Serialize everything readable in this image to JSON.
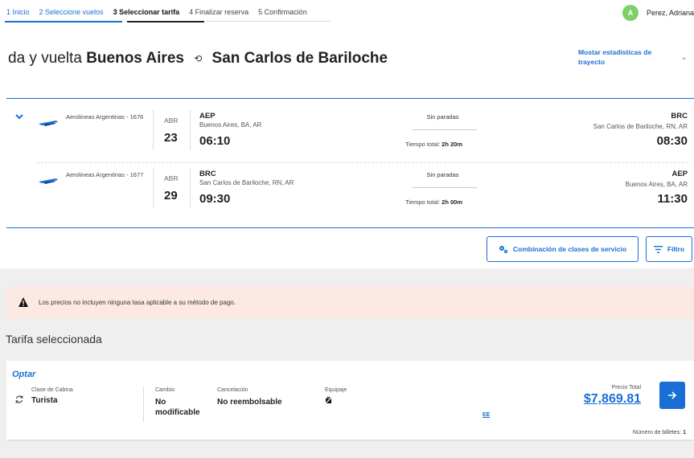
{
  "stepper": {
    "steps": [
      {
        "label": "1  Inicio",
        "state": "done"
      },
      {
        "label": "2  Seleccione vuelos",
        "state": "done"
      },
      {
        "label": "3  Seleccionar tarifa",
        "state": "active"
      },
      {
        "label": "4  Finalizar reserva",
        "state": "pending"
      },
      {
        "label": "5  Confirmación",
        "state": "pending"
      }
    ]
  },
  "user": {
    "initial": "A",
    "name": "Perez, Adriana"
  },
  "header": {
    "title_prefix": "da y vuelta",
    "origin": "Buenos Aires",
    "destination": "San Carlos de Bariloche",
    "stats_link": "Mostar estadísticas de trayecto"
  },
  "flights": [
    {
      "airline": "Aerolineas Argentinas - 1676",
      "month": "ABR",
      "day": "23",
      "dep_code": "AEP",
      "dep_city": "Buenos Aires, BA, AR",
      "dep_time": "06:10",
      "stops": "Sin paradas",
      "total_label": "Tiempo total:",
      "total_value": "2h 20m",
      "arr_code": "BRC",
      "arr_city": "San Carlos de Bariloche, RN, AR",
      "arr_time": "08:30"
    },
    {
      "airline": "Aerolineas Argentinas - 1677",
      "month": "ABR",
      "day": "29",
      "dep_code": "BRC",
      "dep_city": "San Carlos de Bariloche, RN, AR",
      "dep_time": "09:30",
      "stops": "Sin paradas",
      "total_label": "Tiempo total:",
      "total_value": "2h 00m",
      "arr_code": "AEP",
      "arr_city": "Buenos Aires, BA, AR",
      "arr_time": "11:30"
    }
  ],
  "toolbar": {
    "combo_label": "Combinación de clases de servicio",
    "filter_label": "Filtro"
  },
  "alert": {
    "text": "Los precios no incluyen ninguna tasa aplicable a su método de pago."
  },
  "tarifa": {
    "section_title": "Tarifa seleccionada",
    "optar": "Optar",
    "cabin_label": "Clase de Cabina",
    "cabin_value": "Turista",
    "change_label": "Cambio",
    "change_value_1": "No",
    "change_value_2": "modificable",
    "cancel_label": "Cancelación",
    "cancel_value": "No reembolsable",
    "luggage_label": "Equipaje",
    "link_ee": "EE",
    "price_label": "Precio Total",
    "price": "$7,869.81",
    "tickets_label": "Número de billetes:",
    "tickets_count": "1"
  },
  "colors": {
    "accent": "#1a6fd6",
    "alert_bg": "#fce9e4",
    "avatar": "#7fcf6b"
  }
}
